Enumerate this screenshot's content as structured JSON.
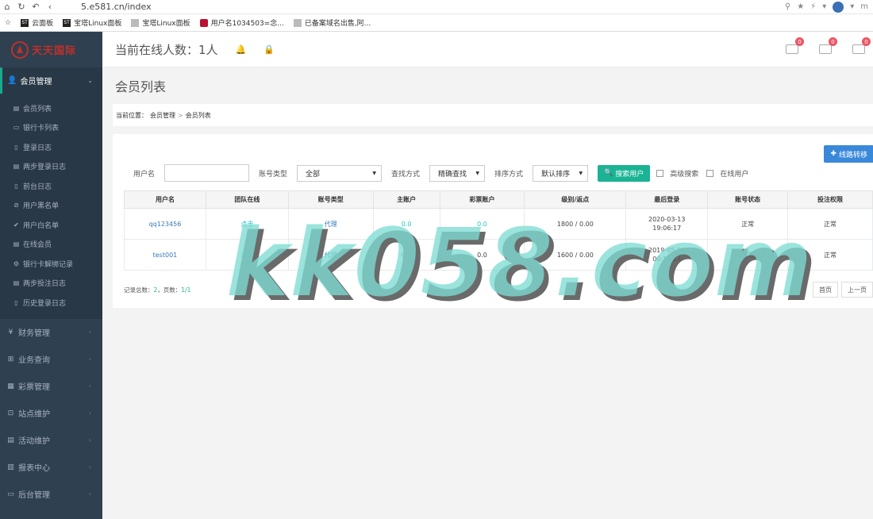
{
  "browser": {
    "url": "5.e581.cn/index",
    "profile_initial": "m",
    "bookmarks": [
      {
        "label": "云面板",
        "icon": "ST"
      },
      {
        "label": "宝塔Linux面板",
        "icon": "ST"
      },
      {
        "label": "宝塔Linux面板",
        "icon": "doc"
      },
      {
        "label": "用户名1034503=念...",
        "icon": "shield"
      },
      {
        "label": "已备案域名出售,阿...",
        "icon": "doc"
      }
    ]
  },
  "sidebar": {
    "brand": "天天国际",
    "active_menu": "会员管理",
    "submenu": [
      {
        "label": "会员列表",
        "icon": "list-icon"
      },
      {
        "label": "银行卡列表",
        "icon": "card-icon"
      },
      {
        "label": "登录日志",
        "icon": "doc-icon"
      },
      {
        "label": "两步登录日志",
        "icon": "list-icon"
      },
      {
        "label": "前台日志",
        "icon": "doc-icon"
      },
      {
        "label": "用户黑名单",
        "icon": "ban-icon"
      },
      {
        "label": "用户白名单",
        "icon": "check-icon"
      },
      {
        "label": "在线会员",
        "icon": "list-icon"
      },
      {
        "label": "银行卡解绑记录",
        "icon": "gear-icon"
      },
      {
        "label": "两步投注日志",
        "icon": "list-icon"
      },
      {
        "label": "历史登录日志",
        "icon": "doc-icon"
      }
    ],
    "menus": [
      {
        "label": "财务管理",
        "icon": "yen-icon",
        "glyph": "¥"
      },
      {
        "label": "业务查询",
        "icon": "sitemap-icon",
        "glyph": "⊞"
      },
      {
        "label": "彩票管理",
        "icon": "qrcode-icon",
        "glyph": "▦"
      },
      {
        "label": "站点维护",
        "icon": "network-icon",
        "glyph": "⊡"
      },
      {
        "label": "活动维护",
        "icon": "calendar-icon",
        "glyph": "▤"
      },
      {
        "label": "报表中心",
        "icon": "bar-chart-icon",
        "glyph": "▥"
      },
      {
        "label": "后台管理",
        "icon": "monitor-icon",
        "glyph": "▭"
      }
    ]
  },
  "topbar": {
    "online_text": "当前在线人数：1人",
    "badges": [
      "0",
      "0",
      "0"
    ]
  },
  "page": {
    "title": "会员列表",
    "breadcrumb_label": "当前位置：",
    "breadcrumb": [
      "会员管理",
      "会员列表"
    ],
    "transfer_button": "线路转移"
  },
  "filters": {
    "username_label": "用户名",
    "account_type_label": "账号类型",
    "account_type_value": "全部",
    "search_method_label": "查找方式",
    "search_method_value": "精确查找",
    "sort_label": "排序方式",
    "sort_value": "默认排序",
    "search_button": "搜索用户",
    "advanced_label": "高级搜索",
    "online_label": "在线用户"
  },
  "table": {
    "columns": [
      "用户名",
      "团队在线",
      "账号类型",
      "主账户",
      "彩票账户",
      "级别/返点",
      "最后登录",
      "账号状态",
      "投注权限"
    ],
    "rows": [
      {
        "username": "qq123456",
        "team_online": "点击",
        "account_type": "代理",
        "main": "0.0",
        "lottery": "0.0",
        "level": "1800 / 0.00",
        "last_login_date": "2020-03-13",
        "last_login_time": "19:06:17",
        "status": "正常",
        "bet_permission": "正常"
      },
      {
        "username": "test001",
        "team_online": "点击",
        "account_type": "代理",
        "main": "0.0",
        "lottery": "0.0",
        "level": "1600 / 0.00",
        "last_login_date": "2019-05-09",
        "last_login_time": "00:11:14",
        "status": "正常",
        "bet_permission": "正常"
      }
    ]
  },
  "footer": {
    "total_label": "记录总数：",
    "total": "2",
    "pages_label": "，页数：",
    "pages": "1/1",
    "first": "首页",
    "prev": "上一页"
  },
  "watermark": "kk058.com",
  "colors": {
    "sidebar_bg": "#2f4050",
    "accent_green": "#1ab394",
    "accent_blue": "#3a88d9",
    "badge_red": "#ed5565"
  }
}
